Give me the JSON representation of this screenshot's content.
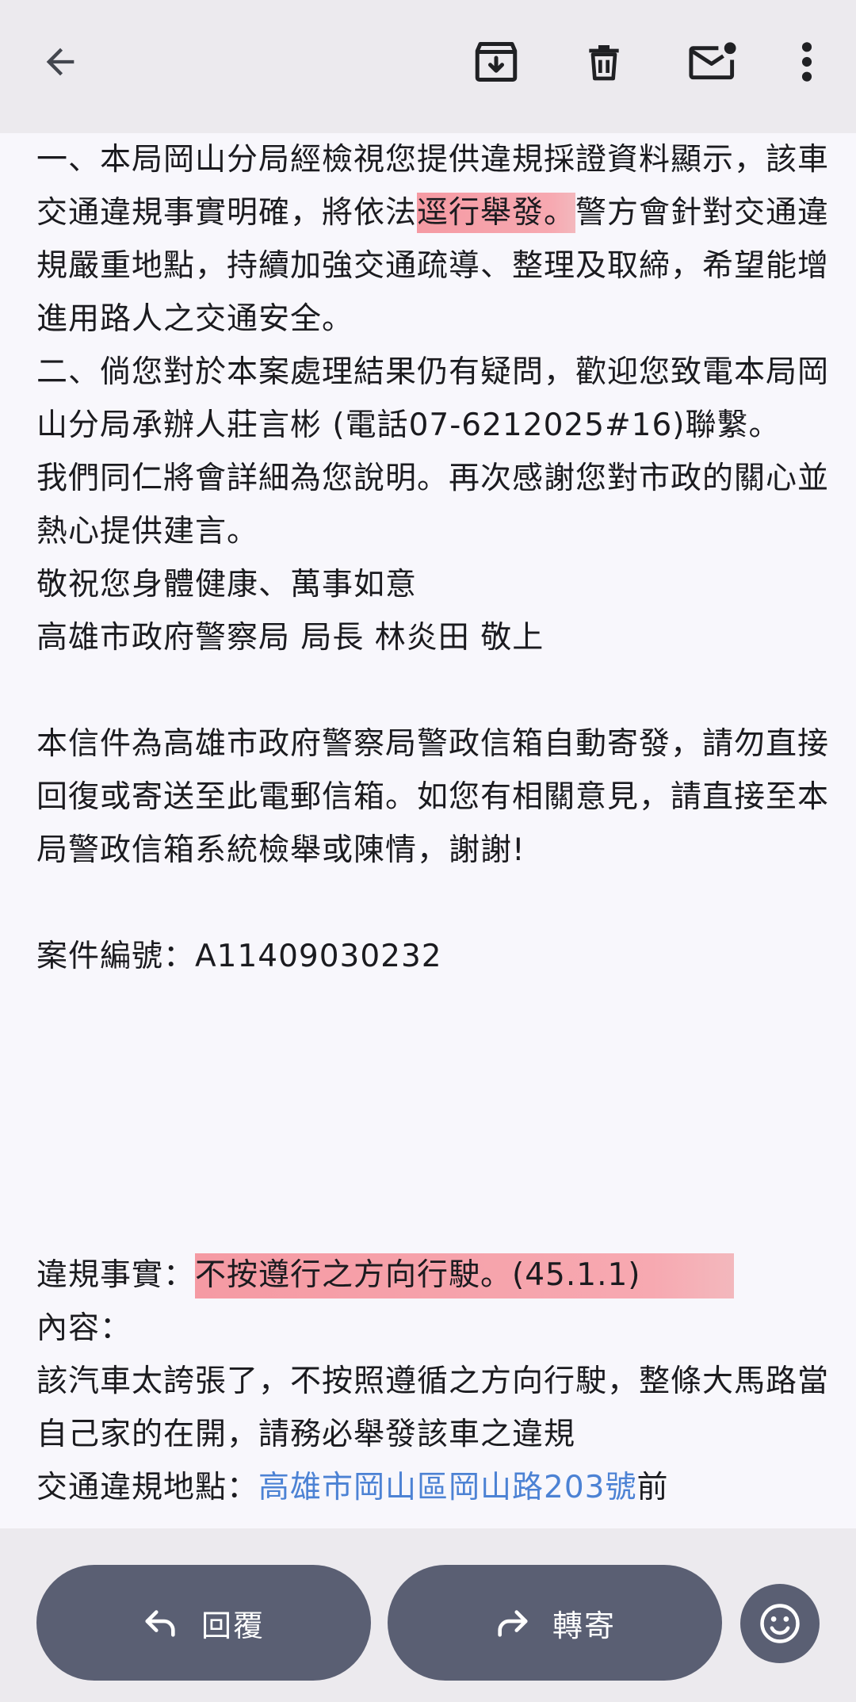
{
  "toolbar": {
    "back_icon": "arrow-left-icon",
    "archive_icon": "archive-icon",
    "delete_icon": "trash-icon",
    "mark_unread_icon": "mail-unread-icon",
    "more_icon": "more-vertical-icon"
  },
  "email": {
    "p1_before": "一、本局岡山分局經檢視您提供違規採證資料顯示，該車交通違規事實明確，將依法",
    "p1_highlight": "逕行舉發。",
    "p1_after": "警方會針對交通違規嚴重地點，持續加強交通疏導、整理及取締，希望能增進用路人之交通安全。",
    "p2": "二、倘您對於本案處理結果仍有疑問，歡迎您致電本局岡山分局承辦人莊言彬 (電話07-6212025#16)聯繫。",
    "p3": "我們同仁將會詳細為您說明。再次感謝您對市政的關心並熱心提供建言。",
    "p4": "敬祝您身體健康、萬事如意",
    "p5": "高雄市政府警察局 局長 林炎田 敬上",
    "notice": "本信件為高雄市政府警察局警政信箱自動寄發，請勿直接回復或寄送至此電郵信箱。如您有相關意見，請直接至本局警政信箱系統檢舉或陳情，謝謝!",
    "case_number": "案件編號：A11409030232",
    "violation_label": "違規事實：",
    "violation_value": "不按遵行之方向行駛。(45.1.1)",
    "content_label": "內容：",
    "content_text": "該汽車太誇張了，不按照遵循之方向行駛，整條大馬路當自己家的在開，請務必舉發該車之違規",
    "location_label": "交通違規地點：",
    "location_link": "高雄市岡山區岡山路203號",
    "location_suffix": "前"
  },
  "actions": {
    "reply_label": "回覆",
    "forward_label": "轉寄",
    "reply_icon": "reply-icon",
    "forward_icon": "forward-icon",
    "emoji_icon": "emoji-smile-icon"
  }
}
